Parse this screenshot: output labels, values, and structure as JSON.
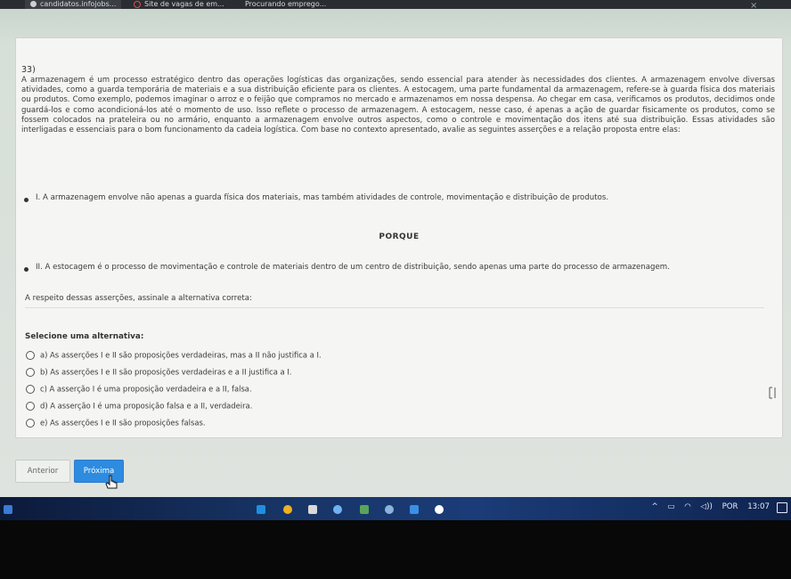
{
  "browser": {
    "tabs": [
      {
        "label": "candidatos.infojobs...",
        "active": true
      },
      {
        "label": "Site de vagas de em..."
      },
      {
        "label": "Procurando emprego..."
      }
    ]
  },
  "question": {
    "number": "33)",
    "text": "A armazenagem é um processo estratégico dentro das operações logísticas das organizações, sendo essencial para atender às necessidades dos clientes. A armazenagem envolve diversas atividades, como a guarda temporária de materiais e a sua distribuição eficiente para os clientes. A estocagem, uma parte fundamental da armazenagem, refere-se à guarda física dos materiais ou produtos. Como exemplo, podemos imaginar o arroz e o feijão que compramos no mercado e armazenamos em nossa despensa. Ao chegar em casa, verificamos os produtos, decidimos onde guardá-los e como acondicioná-los até o momento de uso. Isso reflete o processo de armazenagem. A estocagem, nesse caso, é apenas a ação de guardar fisicamente os produtos, como se fossem colocados na prateleira ou no armário, enquanto a armazenagem envolve outros aspectos, como o controle e movimentação dos itens até sua distribuição. Essas atividades são interligadas e essenciais para o bom funcionamento da cadeia logística. Com base no contexto apresentado, avalie as seguintes asserções e a relação proposta entre elas:",
    "assertion_1": "I. A armazenagem envolve não apenas a guarda física dos materiais, mas também atividades de controle, movimentação e distribuição de produtos.",
    "connector": "PORQUE",
    "assertion_2": "II. A estocagem é o processo de movimentação e controle de materiais dentro de um centro de distribuição, sendo apenas uma parte do processo de armazenagem.",
    "instruction": "A respeito dessas asserções, assinale a alternativa correta:",
    "select_label": "Selecione uma alternativa:",
    "options": [
      "a) As asserções I e II são proposições verdadeiras, mas a II não justifica a I.",
      "b) As asserções I e II são proposições verdadeiras e a II justifica a I.",
      "c) A asserção I é uma proposição verdadeira e a II, falsa.",
      "d) A asserção I é uma proposição falsa e a II, verdadeira.",
      "e) As asserções I e II são proposições falsas."
    ]
  },
  "nav": {
    "prev_label": "Anterior",
    "next_label": "Próxima"
  },
  "taskbar": {
    "language": "POR",
    "time": "13:07"
  },
  "colors": {
    "accent": "#2d8be0",
    "taskbar": "#173465"
  }
}
